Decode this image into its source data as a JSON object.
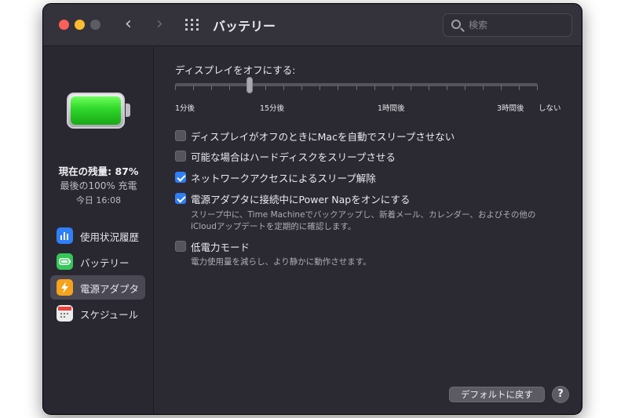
{
  "window": {
    "title": "バッテリー",
    "nav_back": "‹",
    "nav_forward": "›",
    "search_placeholder": "検索"
  },
  "sidebar": {
    "charge_main": "現在の残量: 87%",
    "charge_sub": "最後の100% 充電",
    "charge_time": "今日 16:08",
    "items": [
      {
        "label": "使用状況履歴",
        "icon": "usage-history-icon",
        "color": "#2f7ff6",
        "glyph": "▮"
      },
      {
        "label": "バッテリー",
        "icon": "battery-icon",
        "color": "#35c759",
        "glyph": "▭"
      },
      {
        "label": "電源アダプタ",
        "icon": "power-adapter-icon",
        "color": "#f7a21b",
        "glyph": "⚡"
      },
      {
        "label": "スケジュール",
        "icon": "calendar-icon",
        "color": "#e9e7ea",
        "glyph": "▦"
      }
    ],
    "active_index": 2
  },
  "main": {
    "display_off_label": "ディスプレイをオフにする:",
    "slider_labels": [
      "1分後",
      "15分後",
      "1時間後",
      "3時間後",
      "しない"
    ],
    "options": [
      {
        "label": "ディスプレイがオフのときにMacを自動でスリープさせない",
        "checked": false
      },
      {
        "label": "可能な場合はハードディスクをスリープさせる",
        "checked": false
      },
      {
        "label": "ネットワークアクセスによるスリープ解除",
        "checked": true
      },
      {
        "label": "電源アダプタに接続中にPower Napをオンにする",
        "checked": true,
        "desc": [
          "スリープ中に、Time Machineでバックアップし、新着メール、カレンダー、およびその他の",
          "iCloudアップデートを定期的に確認します。"
        ]
      },
      {
        "label": "低電力モード",
        "checked": false,
        "desc": [
          "電力使用量を減らし、より静かに動作させます。"
        ]
      }
    ],
    "default_button": "デフォルトに戻す",
    "help_button": "?"
  }
}
